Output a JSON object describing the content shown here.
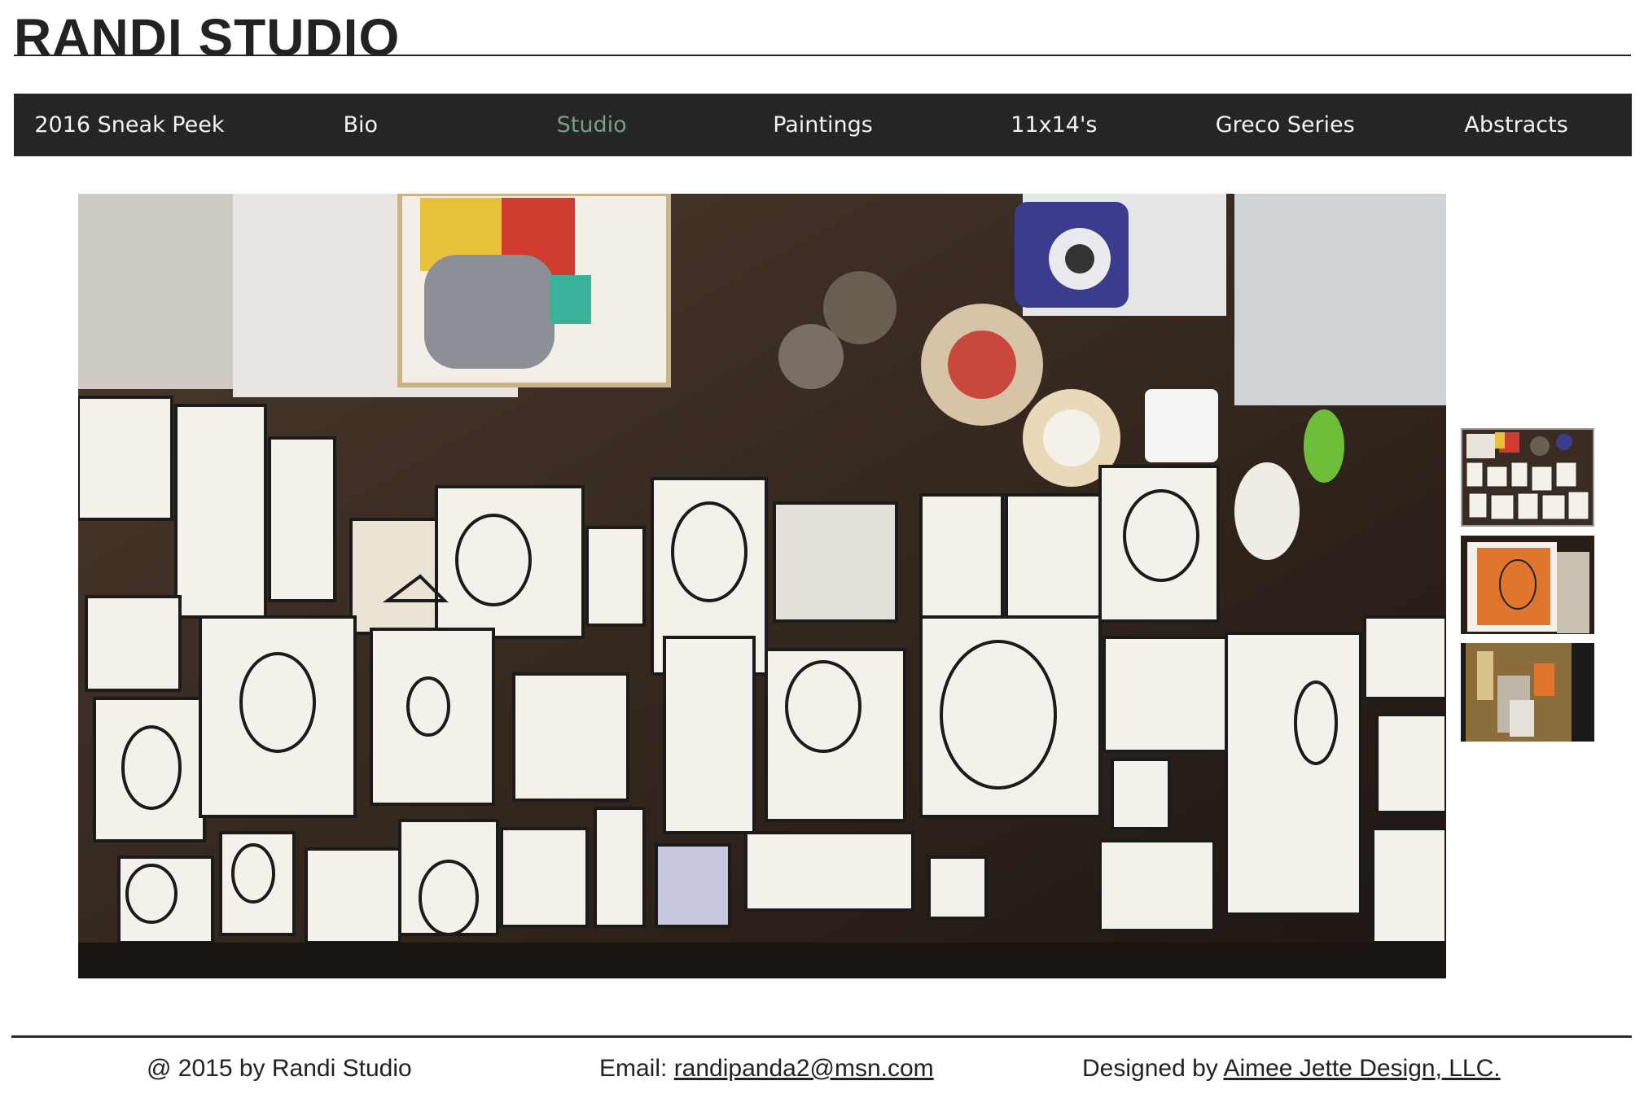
{
  "site": {
    "title": "RANDI STUDIO"
  },
  "nav": {
    "items": [
      {
        "label": "2016 Sneak Peek"
      },
      {
        "label": "Bio"
      },
      {
        "label": "Studio",
        "active": true
      },
      {
        "label": "Paintings"
      },
      {
        "label": "11x14's"
      },
      {
        "label": "Greco Series"
      },
      {
        "label": "Abstracts"
      }
    ],
    "active_color": "#7b9e86",
    "bar_color": "#252525"
  },
  "gallery": {
    "selected_index": 0,
    "thumbnail_count": 3
  },
  "footer": {
    "copyright": "@ 2015 by Randi Studio",
    "email_label": "Email: ",
    "email": "randipanda2@msn.com",
    "designed_label": "Designed by ",
    "designer": "Aimee Jette Design, LLC."
  }
}
